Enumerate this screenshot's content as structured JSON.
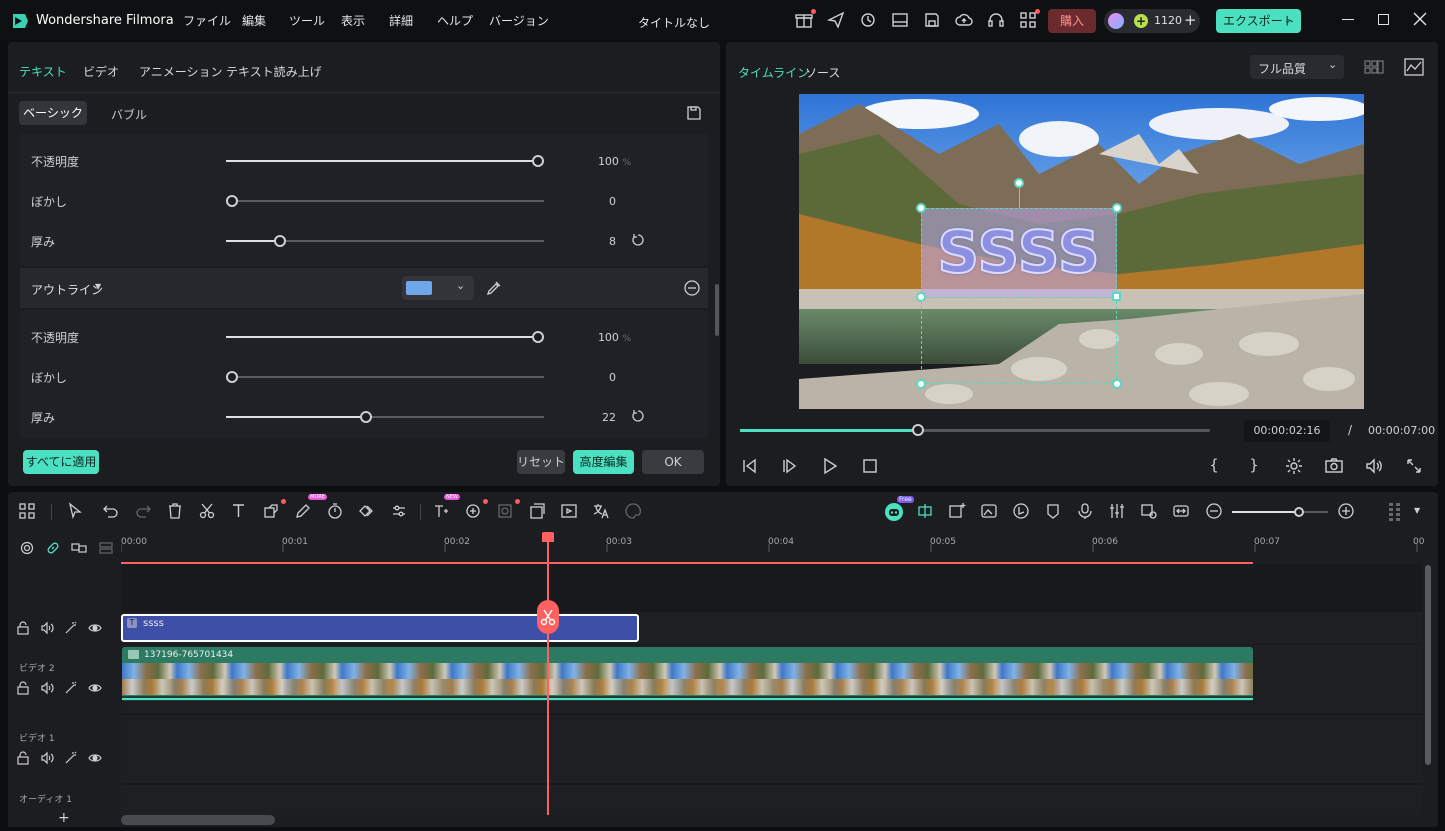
{
  "app": {
    "name": "Wondershare Filmora",
    "menu": [
      "ファイル",
      "編集",
      "ツール",
      "表示",
      "詳細",
      "ヘルプ",
      "バージョン"
    ],
    "project_title": "タイトルなし",
    "buy_label": "購入",
    "credits": "1120",
    "export_label": "エクスポート"
  },
  "properties": {
    "tabs": [
      "テキスト",
      "ビデオ",
      "アニメーション",
      "テキスト読み上げ"
    ],
    "active_tab": "テキスト",
    "subtabs": [
      "ベーシック",
      "バブル"
    ],
    "group1": {
      "rows": [
        {
          "label": "不透明度",
          "value": "100",
          "unit": "%",
          "fraction": 1.0
        },
        {
          "label": "ぼかし",
          "value": "0",
          "unit": "",
          "fraction": 0.0
        },
        {
          "label": "厚み",
          "value": "8",
          "unit": "",
          "fraction": 0.16,
          "reset": true
        }
      ]
    },
    "outline": {
      "label": "アウトライン",
      "color": "#6fa8e8",
      "rows": [
        {
          "label": "不透明度",
          "value": "100",
          "unit": "%",
          "fraction": 1.0
        },
        {
          "label": "ぼかし",
          "value": "0",
          "unit": "",
          "fraction": 0.0
        },
        {
          "label": "厚み",
          "value": "22",
          "unit": "",
          "fraction": 0.44,
          "reset": true
        }
      ]
    },
    "apply_all_label": "すべてに適用",
    "reset_label": "リセット",
    "advanced_label": "高度編集",
    "ok_label": "OK"
  },
  "preview": {
    "tabs": [
      "タイムライン",
      "ソース"
    ],
    "quality": "フル品質",
    "overlay_text": "SSSS",
    "current_time": "00:00:02:16",
    "separator": "/",
    "total_time": "00:00:07:00",
    "progress": 0.38
  },
  "timeline": {
    "ruler": [
      "00:00",
      "00:01",
      "00:02",
      "00:03",
      "00:04",
      "00:05",
      "00:06",
      "00:07",
      "00"
    ],
    "tracks": [
      {
        "name": "",
        "clip_label": "ssss",
        "type": "title"
      },
      {
        "name": "ビデオ 2",
        "clip_label": "137196-765701434",
        "type": "video"
      },
      {
        "name": "ビデオ 1",
        "clip_label": "",
        "type": "empty"
      },
      {
        "name": "オーディオ 1",
        "clip_label": "",
        "type": "audio"
      }
    ],
    "new_badge": "NEW",
    "free_badge": "Free",
    "more_badge": "MORE"
  }
}
